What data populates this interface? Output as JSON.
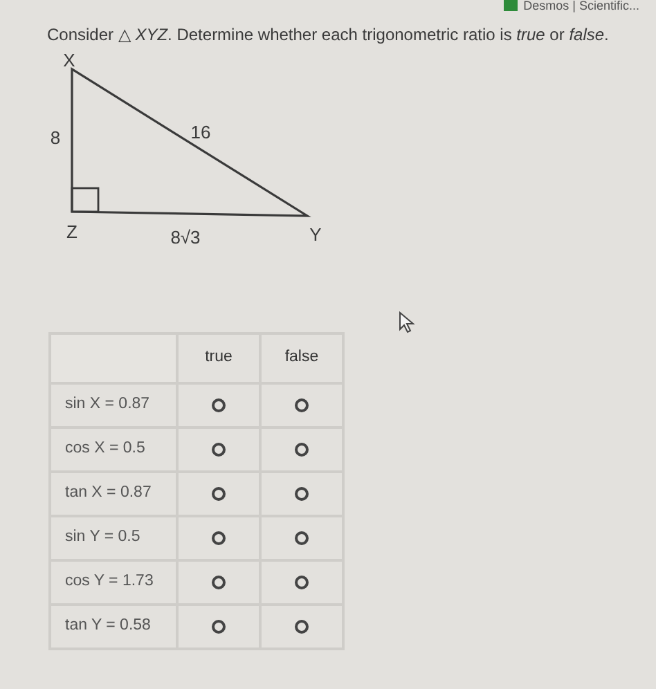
{
  "bookmark": {
    "label": "Desmos | Scientific..."
  },
  "prompt": "Consider △ *XYZ*. Determine whether each trigonometric ratio is *true* or *false*.",
  "triangle": {
    "vertices": [
      "X",
      "Z",
      "Y"
    ],
    "sides": [
      "8",
      "16",
      "8√3"
    ]
  },
  "table": {
    "columns": [
      "true",
      "false"
    ],
    "rows": [
      {
        "label": "sin X = 0.87",
        "choices": [
          {
            "selected": false
          },
          {
            "selected": false
          }
        ]
      },
      {
        "label": "cos X = 0.5",
        "choices": [
          {
            "selected": false
          },
          {
            "selected": false
          }
        ]
      },
      {
        "label": "tan X = 0.87",
        "choices": [
          {
            "selected": false
          },
          {
            "selected": false
          }
        ]
      },
      {
        "label": "sin Y = 0.5",
        "choices": [
          {
            "selected": false
          },
          {
            "selected": false
          }
        ]
      },
      {
        "label": "cos Y = 1.73",
        "choices": [
          {
            "selected": false
          },
          {
            "selected": false
          }
        ]
      },
      {
        "label": "tan Y = 0.58",
        "choices": [
          {
            "selected": false
          },
          {
            "selected": false
          }
        ]
      }
    ]
  }
}
